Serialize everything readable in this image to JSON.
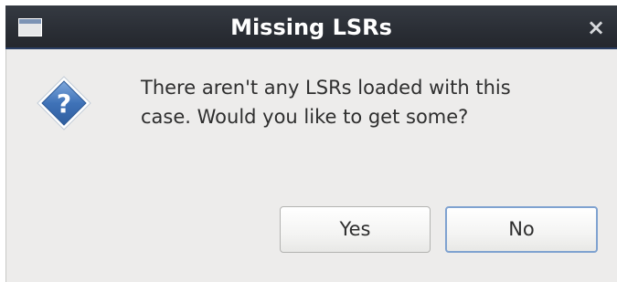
{
  "window": {
    "title": "Missing LSRs",
    "close_glyph": "×",
    "window_icon": "window-icon"
  },
  "dialog": {
    "icon": "question-icon",
    "message": "There aren't any LSRs loaded with this\ncase. Would you like to get some?",
    "buttons": {
      "yes_label": "Yes",
      "no_label": "No",
      "default": "No"
    }
  },
  "colors": {
    "titlebar": "#2b2f36",
    "titlebar_accent": "#2a3e63",
    "dialog_bg": "#edeceb",
    "icon_blue": "#3f72b8",
    "focus_border": "#7fa2d0"
  }
}
